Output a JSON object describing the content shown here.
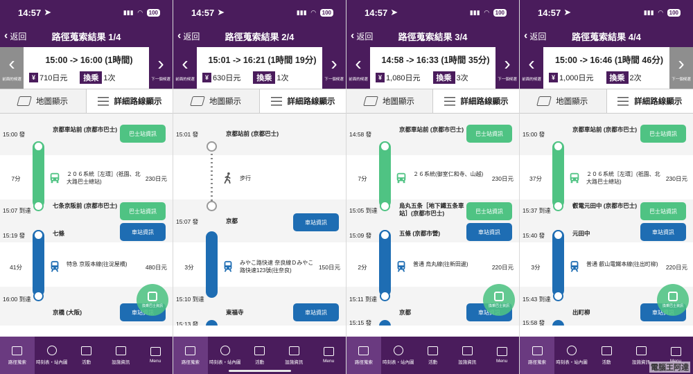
{
  "status": {
    "time": "14:57",
    "battery": "100"
  },
  "common": {
    "back": "返回",
    "prev_cap": "前面的候選",
    "next_cap": "下一個候選",
    "yen_mark": "¥",
    "xfer_tag": "換乘",
    "tab_map": "地圖顯示",
    "tab_detail": "詳細路線顯示",
    "bus_info": "巴士站資訊",
    "station_info": "車站資訊",
    "fab_label": "換乘巴士資訊",
    "colors": {
      "brand": "#4a1c5c",
      "bus": "#4fc383",
      "rail": "#1e6db3"
    },
    "bottom_nav": [
      "路徑蒐索",
      "時刻表・站內圖",
      "活動",
      "設施資訊",
      "Menu"
    ]
  },
  "screens": [
    {
      "title": "路徑蒐索結果 1/4",
      "time_range": "15:00 -> 16:00 (1時間)",
      "fare": "710日元",
      "transfers": "1次",
      "prev_enabled": false,
      "t1": "15:00 發",
      "s1": "京都車站前 (京都市巴士)",
      "d1": "7分",
      "l1": "２０６系統［左環］(祇園、北大路巴士總站)",
      "f1": "230日元",
      "t2": "15:07 到達",
      "s2": "七条京阪前 (京都市巴士)",
      "t3": "15:19 發",
      "s3": "七條",
      "d2": "41分",
      "l2": "特急 京阪本線(往淀屋橋)",
      "f2": "480日元",
      "t4": "16:00 到達",
      "s4": "京橋 (大阪)"
    },
    {
      "title": "路徑蒐索結果 2/4",
      "time_range": "15:01 -> 16:21 (1時間 19分)",
      "fare": "630日元",
      "transfers": "1次",
      "prev_enabled": true,
      "t1": "15:01 發",
      "s1": "京都站前 (京都巴士)",
      "walk": "步行",
      "t3": "15:07 發",
      "s3": "京都",
      "d2": "3分",
      "l2": "みやこ路快速 奈良線Ｄみやこ路快速123號(往奈良)",
      "f2": "150日元",
      "t4": "15:10 到達",
      "s4": "東福寺",
      "t5": "15:13 發"
    },
    {
      "title": "路徑蒐索結果 3/4",
      "time_range": "14:58 -> 16:33 (1時間 35分)",
      "fare": "1,080日元",
      "transfers": "3次",
      "prev_enabled": true,
      "t1": "14:58 發",
      "s1": "京都車站前 (京都市巴士)",
      "d1": "7分",
      "l1": "２６系統(御室仁和寺、山越)",
      "f1": "230日元",
      "t2": "15:05 到達",
      "s2": "烏丸五条［地下鐵五条車站］(京都市巴士)",
      "t3": "15:09 發",
      "s3": "五條 (京都市營)",
      "d2": "2分",
      "l2": "普通 烏丸線(往新田邊)",
      "f2": "220日元",
      "t4": "15:11 到達",
      "s4": "京都",
      "t5": "15:15 發"
    },
    {
      "title": "路徑蒐索結果 4/4",
      "time_range": "15:00 -> 16:46 (1時間 46分)",
      "fare": "1,000日元",
      "transfers": "2次",
      "prev_enabled": true,
      "t1": "15:00 發",
      "s1": "京都車站前 (京都市巴士)",
      "d1": "37分",
      "l1": "２０６系統［左環］(祇園、北大路巴士總站)",
      "f1": "230日元",
      "t2": "15:37 到達",
      "s2": "叡電元田中 (京都市巴士)",
      "t3": "15:40 發",
      "s3": "元田中",
      "d2": "3分",
      "l2": "普通 叡山電鐵本線(往出町柳)",
      "f2": "220日元",
      "t4": "15:43 到達",
      "s4": "出町柳",
      "t5": "15:58 發"
    }
  ],
  "watermark": "電腦王阿達"
}
